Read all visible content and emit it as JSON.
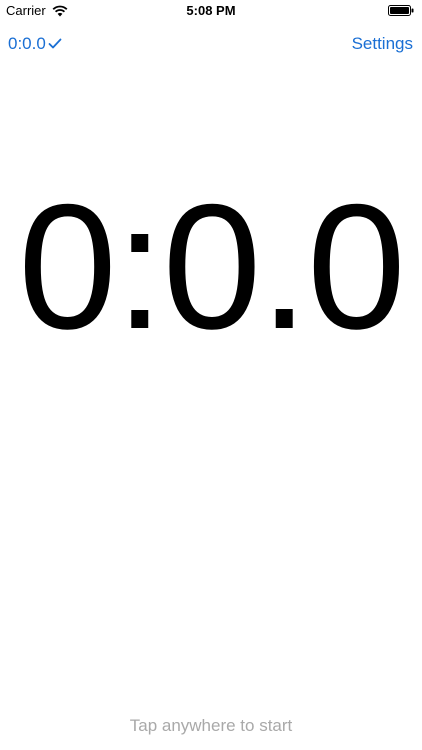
{
  "status_bar": {
    "carrier": "Carrier",
    "time": "5:08 PM",
    "wifi_icon": "wifi-icon",
    "battery_icon": "battery-icon"
  },
  "nav": {
    "left_label": "0:0.0",
    "left_icon": "check-icon",
    "right_label": "Settings"
  },
  "timer": {
    "value": "0:0.0"
  },
  "hint": {
    "text": "Tap anywhere to start"
  },
  "colors": {
    "accent": "#1a6fd4",
    "hint": "#a9a9a9",
    "text": "#000000",
    "background": "#ffffff"
  }
}
